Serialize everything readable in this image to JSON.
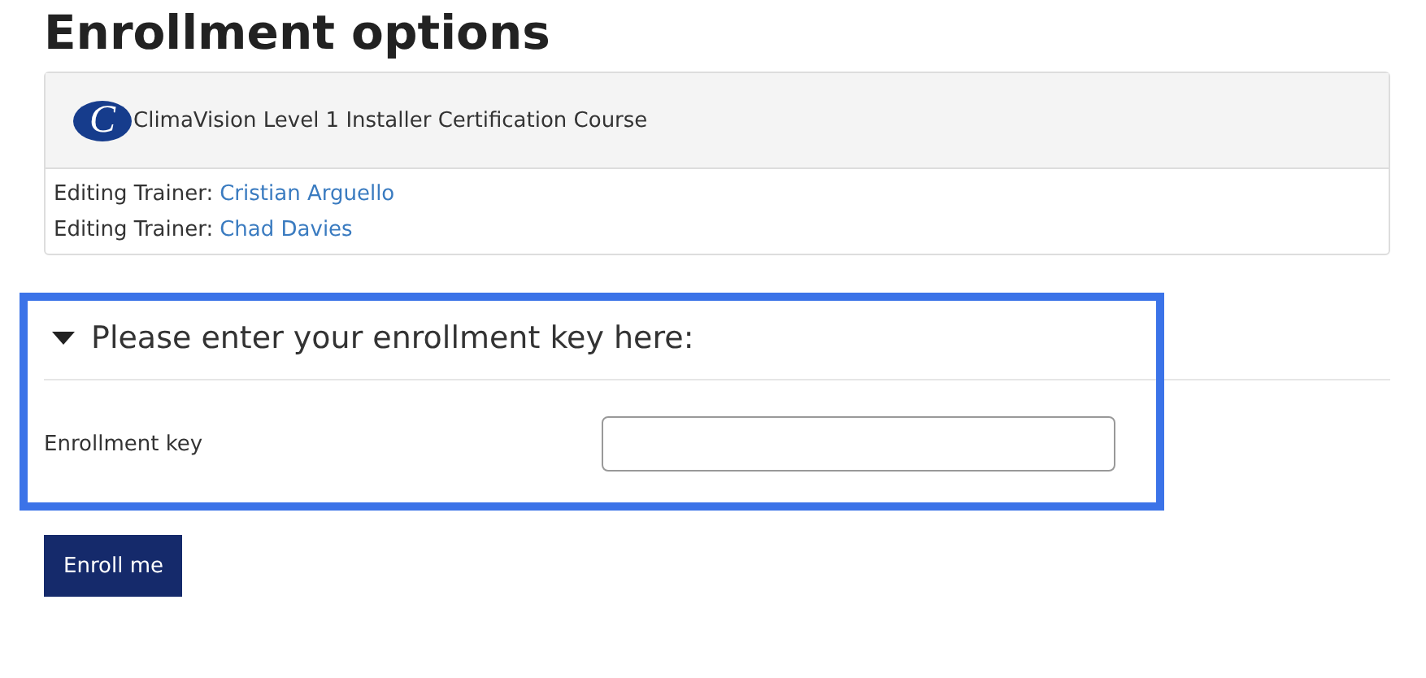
{
  "page": {
    "title": "Enrollment options"
  },
  "course": {
    "logo_letter": "C",
    "name": "ClimaVision Level 1 Installer Certification Course",
    "trainers": [
      {
        "label": "Editing Trainer:",
        "name": "Cristian Arguello"
      },
      {
        "label": "Editing Trainer:",
        "name": "Chad Davies"
      }
    ]
  },
  "enrollment_section": {
    "heading": "Please enter your enrollment key here:",
    "expanded": true,
    "highlighted": true,
    "field": {
      "label": "Enrollment key"
    }
  },
  "buttons": [
    "Enroll me"
  ]
}
